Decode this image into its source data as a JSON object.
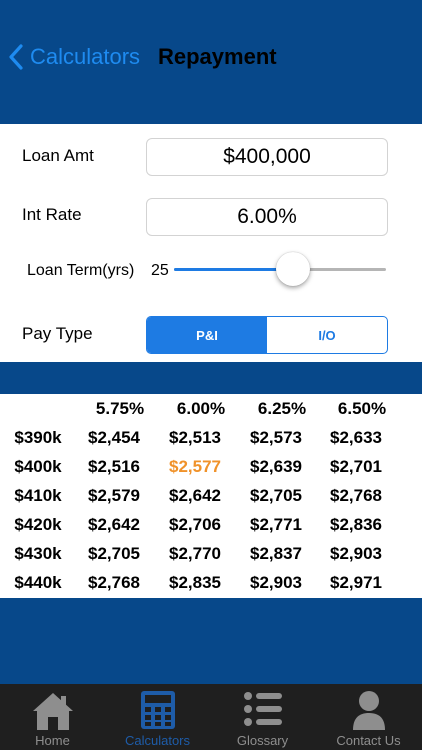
{
  "colors": {
    "brand": "#07488a",
    "accent": "#1e7be3",
    "highlight": "#f0922a"
  },
  "nav": {
    "back_label": "Calculators",
    "title": "Repayment"
  },
  "form": {
    "loan_amt_label": "Loan Amt",
    "loan_amt_value": "$400,000",
    "int_rate_label": "Int Rate",
    "int_rate_value": "6.00%",
    "term_label": "Loan Term(yrs)",
    "term_value": "25",
    "term_slider_fraction": 0.56,
    "pay_type_label": "Pay Type",
    "pay_type_options": [
      "P&I",
      "I/O"
    ],
    "pay_type_selected": "P&I"
  },
  "table": {
    "rates": [
      "5.75%",
      "6.00%",
      "6.25%",
      "6.50%"
    ],
    "rows": [
      {
        "amount": "$390k",
        "values": [
          "$2,454",
          "$2,513",
          "$2,573",
          "$2,633"
        ]
      },
      {
        "amount": "$400k",
        "values": [
          "$2,516",
          "$2,577",
          "$2,639",
          "$2,701"
        ]
      },
      {
        "amount": "$410k",
        "values": [
          "$2,579",
          "$2,642",
          "$2,705",
          "$2,768"
        ]
      },
      {
        "amount": "$420k",
        "values": [
          "$2,642",
          "$2,706",
          "$2,771",
          "$2,836"
        ]
      },
      {
        "amount": "$430k",
        "values": [
          "$2,705",
          "$2,770",
          "$2,837",
          "$2,903"
        ]
      },
      {
        "amount": "$440k",
        "values": [
          "$2,768",
          "$2,835",
          "$2,903",
          "$2,971"
        ]
      }
    ],
    "highlight": {
      "row": 1,
      "col": 1
    }
  },
  "tabbar": {
    "items": [
      {
        "label": "Home",
        "icon": "house-icon"
      },
      {
        "label": "Calculators",
        "icon": "calculator-icon"
      },
      {
        "label": "Glossary",
        "icon": "list-icon"
      },
      {
        "label": "Contact Us",
        "icon": "person-icon"
      }
    ],
    "active": 1
  }
}
